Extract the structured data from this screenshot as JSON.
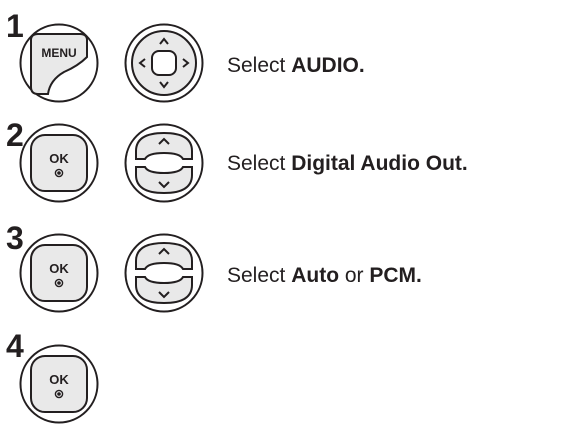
{
  "steps": [
    {
      "number": "1",
      "buttons": [
        "menu-button",
        "navigation-pad"
      ],
      "menu_label": "MENU",
      "text_prefix": "Select ",
      "text_bold": "AUDIO."
    },
    {
      "number": "2",
      "buttons": [
        "ok-button",
        "up-down-button"
      ],
      "ok_label": "OK",
      "text_prefix": "Select ",
      "text_bold": "Digital Audio Out."
    },
    {
      "number": "3",
      "buttons": [
        "ok-button",
        "up-down-button"
      ],
      "ok_label": "OK",
      "text_prefix": "Select ",
      "text_bold": "Auto",
      "text_middle": " or ",
      "text_bold2": "PCM."
    },
    {
      "number": "4",
      "buttons": [
        "ok-button"
      ],
      "ok_label": "OK"
    }
  ],
  "colors": {
    "button_fill": "#e9e9e9",
    "button_outer": "#ffffff",
    "stroke": "#231f20"
  }
}
